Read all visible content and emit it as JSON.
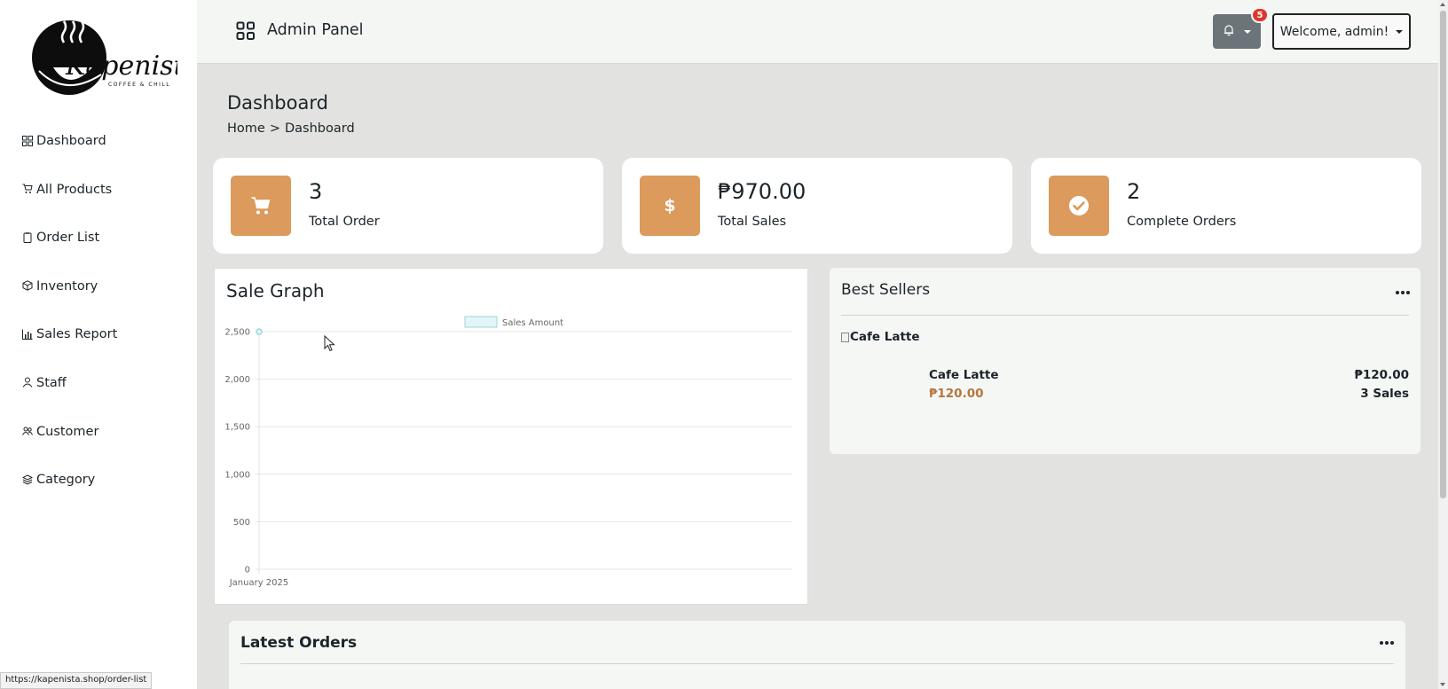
{
  "brand": {
    "logo_text": "Kapenista",
    "logo_tagline": "COFFEE & CHILL"
  },
  "sidebar": {
    "items": [
      {
        "label": "Dashboard",
        "icon": "dashboard-icon"
      },
      {
        "label": "All Products",
        "icon": "cart-icon"
      },
      {
        "label": "Order List",
        "icon": "clipboard-icon"
      },
      {
        "label": "Inventory",
        "icon": "box-icon"
      },
      {
        "label": "Sales Report",
        "icon": "bar-chart-icon"
      },
      {
        "label": "Staff",
        "icon": "person-icon"
      },
      {
        "label": "Customer",
        "icon": "people-icon"
      },
      {
        "label": "Category",
        "icon": "layers-icon"
      }
    ]
  },
  "header": {
    "title": "Admin Panel",
    "notification_count": "5",
    "welcome": "Welcome, admin!"
  },
  "page": {
    "title": "Dashboard",
    "breadcrumb": {
      "home": "Home",
      "separator": ">",
      "current": "Dashboard"
    }
  },
  "stats": [
    {
      "value": "3",
      "label": "Total Order",
      "icon": "cart-icon"
    },
    {
      "value": "₱970.00",
      "label": "Total Sales",
      "icon": "dollar-icon"
    },
    {
      "value": "2",
      "label": "Complete Orders",
      "icon": "check-circle-icon"
    }
  ],
  "sale_graph": {
    "title": "Sale Graph"
  },
  "chart_data": {
    "type": "line",
    "title": "",
    "categories": [
      "January 2025"
    ],
    "series": [
      {
        "name": "Sales Amount",
        "values": [
          2500
        ]
      }
    ],
    "yticks": [
      "0",
      "500",
      "1,000",
      "1,500",
      "2,000",
      "2,500"
    ],
    "ylim": [
      0,
      2500
    ],
    "grid": true,
    "legend": "top-center",
    "series_color": "#9ad6dd"
  },
  "best_sellers": {
    "title": "Best Sellers",
    "items": [
      {
        "image_alt": "Cafe Latte",
        "name": "Cafe Latte",
        "price": "₱120.00",
        "total": "₱120.00",
        "sales": "3 Sales"
      }
    ]
  },
  "latest_orders": {
    "title": "Latest Orders"
  },
  "status_bar": {
    "url": "https://kapenista.shop/order-list"
  },
  "colors": {
    "accent": "#dc9a5c",
    "sidebar_bg": "#ffffff",
    "content_bg": "#e2e3e0",
    "badge": "#e0362c"
  }
}
